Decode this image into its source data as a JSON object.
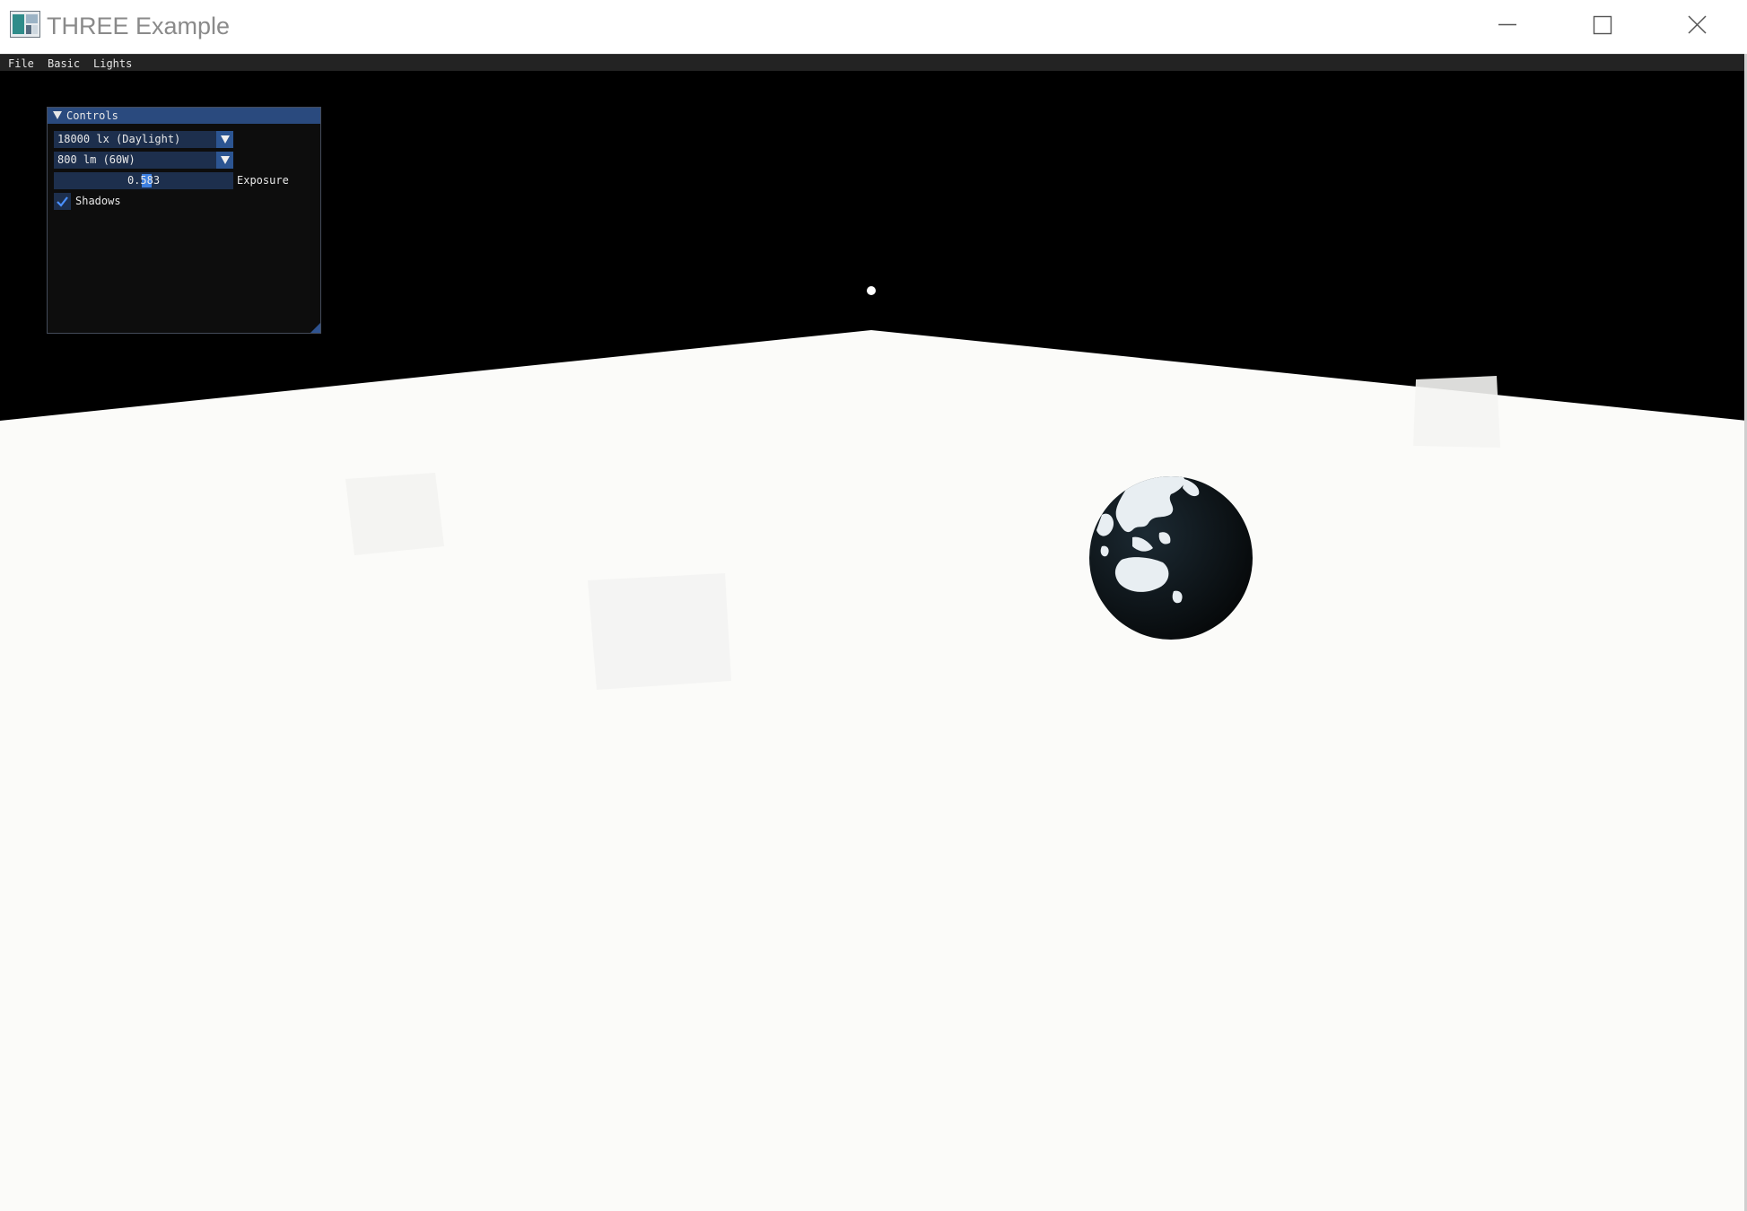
{
  "window": {
    "title": "THREE Example",
    "icon": "app-window-icon",
    "controls": [
      "minimize-icon",
      "maximize-icon",
      "close-icon"
    ]
  },
  "menu": {
    "file": "File",
    "basic": "Basic",
    "lights": "Lights"
  },
  "controls_panel": {
    "title": "Controls",
    "hemisphere_lux": "18000 lx (Daylight)",
    "bulb_power": "800 lm (60W)",
    "exposure_value": "0.583",
    "exposure_label": "Exposure",
    "shadows_label": "Shadows",
    "shadows_checked": true
  },
  "colors": {
    "menu_bg": "#232323",
    "panel_header": "#2a4a7e",
    "frame_bg": "#1d2f4d",
    "accent": "#3d7fe0",
    "floor": "#fbfbf9",
    "sky": "#000000"
  }
}
